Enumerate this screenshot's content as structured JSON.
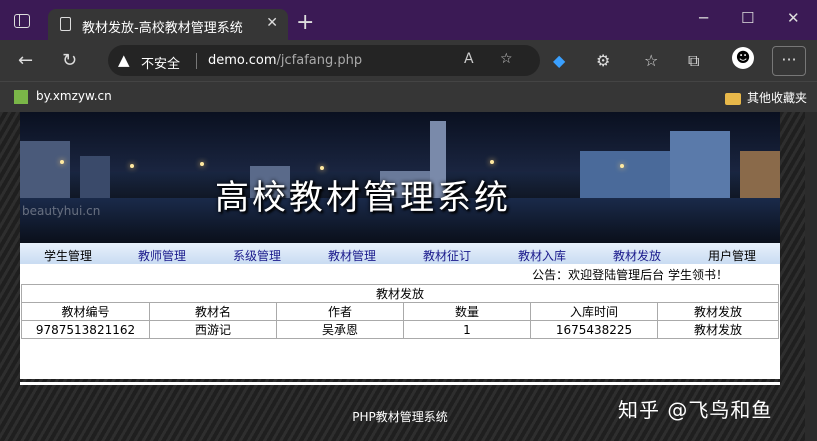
{
  "browser": {
    "tab_title": "教材发放-高校教材管理系统",
    "security_label": "不安全",
    "url_host": "demo.com",
    "url_path": "/jcfafang.php",
    "bookmark_site": "by.xmzyw.cn",
    "other_bookmarks": "其他收藏夹"
  },
  "banner": {
    "title": "高校教材管理系统",
    "watermark": "beautyhui.cn"
  },
  "menu": [
    "学生管理",
    "教师管理",
    "系级管理",
    "教材管理",
    "教材征订",
    "教材入库",
    "教材发放",
    "用户管理"
  ],
  "notice": "公告：欢迎登陆管理后台 学生领书！",
  "table": {
    "caption": "教材发放",
    "headers": [
      "教材编号",
      "教材名",
      "作者",
      "数量",
      "入库时间",
      "教材发放"
    ],
    "rows": [
      [
        "9787513821162",
        "西游记",
        "吴承恩",
        "1",
        "1675438225",
        "教材发放"
      ]
    ]
  },
  "footer": "PHP教材管理系统",
  "overlay_watermark": "知乎 @飞鸟和鱼"
}
